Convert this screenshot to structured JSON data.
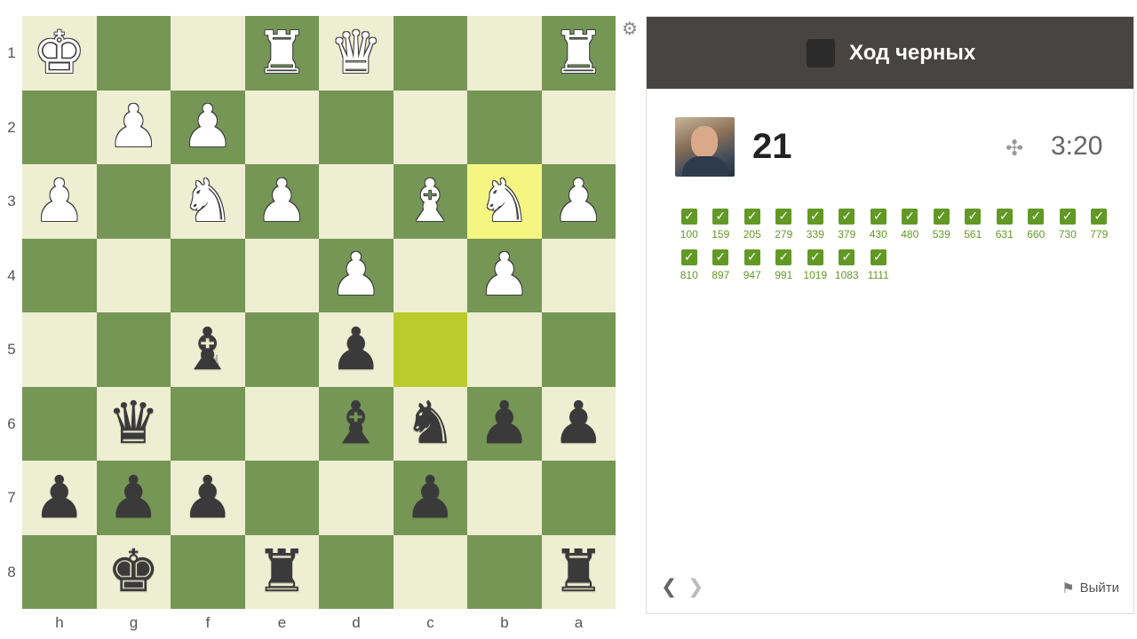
{
  "board": {
    "ranks": [
      "1",
      "2",
      "3",
      "4",
      "5",
      "6",
      "7",
      "8"
    ],
    "files": [
      "h",
      "g",
      "f",
      "e",
      "d",
      "c",
      "b",
      "a"
    ],
    "rows": [
      [
        "wk",
        "",
        "",
        "wr",
        "wq",
        "",
        "",
        "wr"
      ],
      [
        "",
        "wp",
        "wp",
        "",
        "",
        "",
        "",
        ""
      ],
      [
        "wp",
        "",
        "wn",
        "wp",
        "",
        "wb",
        "wn",
        "wp"
      ],
      [
        "",
        "",
        "",
        "",
        "wp",
        "",
        "wp",
        ""
      ],
      [
        "",
        "",
        "bb",
        "",
        "bp",
        "",
        "",
        ""
      ],
      [
        "",
        "bq",
        "",
        "",
        "bb",
        "bn",
        "bp",
        "bp"
      ],
      [
        "bp",
        "bp",
        "bp",
        "",
        "",
        "bp",
        "",
        ""
      ],
      [
        "",
        "bk",
        "",
        "br",
        "",
        "",
        "",
        "br"
      ]
    ],
    "highlights": {
      "2-6": "hl-yellow",
      "4-5": "hl-olive"
    }
  },
  "pieces": {
    "wk": "♚",
    "wq": "♛",
    "wr": "♜",
    "wb": "♝",
    "wn": "♞",
    "wp": "♟",
    "bk": "♚",
    "bq": "♛",
    "br": "♜",
    "bb": "♝",
    "bn": "♞",
    "bp": "♟"
  },
  "colors": {
    "light": "#eeeed2",
    "dark": "#769656",
    "success": "#629924",
    "header": "#474441"
  },
  "icons": {
    "settings": "gear-icon",
    "puzzle": "puzzle-icon",
    "prev": "chevron-left-icon",
    "next": "chevron-right-icon",
    "exit": "flag-icon"
  },
  "panel": {
    "turn_text": "Ход черных",
    "score": "21",
    "timer": "3:20",
    "results": [
      "100",
      "159",
      "205",
      "279",
      "339",
      "379",
      "430",
      "480",
      "539",
      "561",
      "631",
      "660",
      "730",
      "779",
      "810",
      "897",
      "947",
      "991",
      "1019",
      "1083",
      "1111"
    ],
    "exit_label": "Выйти"
  }
}
